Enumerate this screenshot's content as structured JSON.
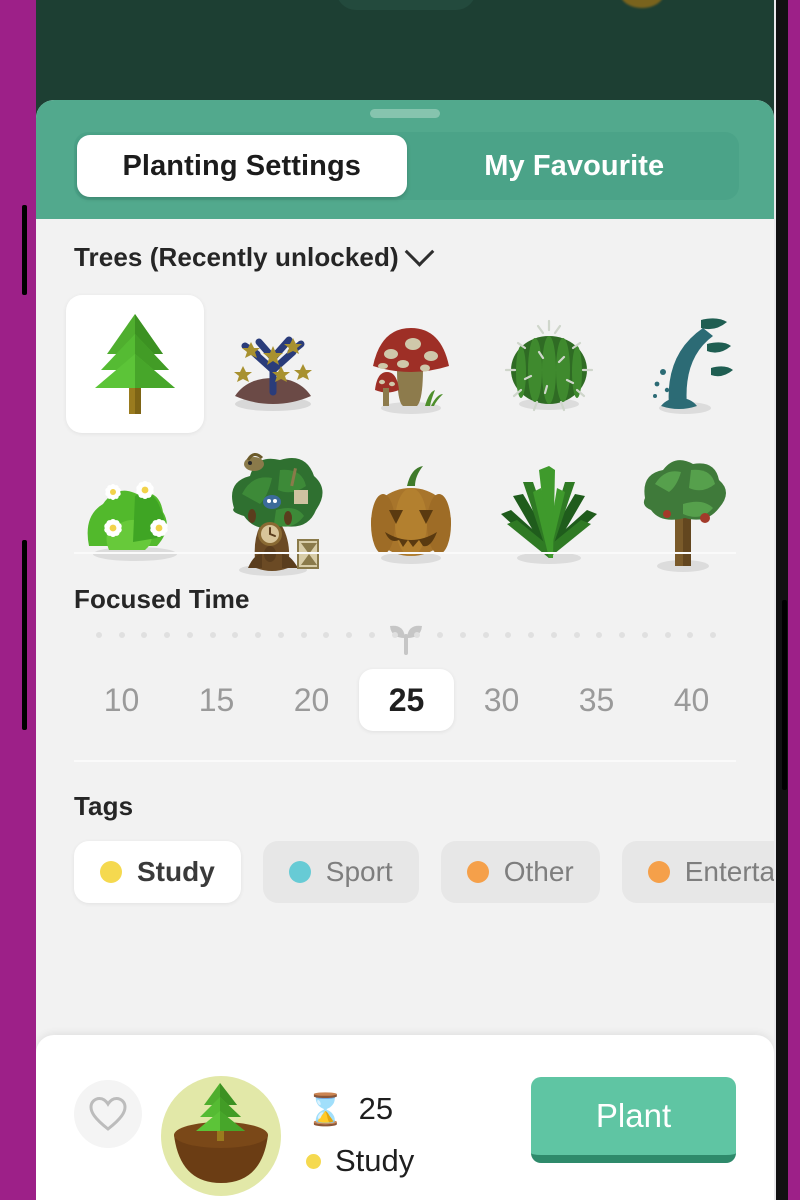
{
  "tabs": {
    "items": [
      {
        "label": "Planting Settings",
        "active": true
      },
      {
        "label": "My Favourite",
        "active": false
      }
    ]
  },
  "trees": {
    "section_label": "Trees (Recently unlocked)",
    "expand_icon": "chevron-down-icon",
    "rows": [
      [
        {
          "name": "pine-tree",
          "selected": true
        },
        {
          "name": "blue-star-bush",
          "selected": false
        },
        {
          "name": "red-mushroom",
          "selected": false
        },
        {
          "name": "round-cactus",
          "selected": false
        },
        {
          "name": "teal-fountain-plant",
          "selected": false
        }
      ],
      [
        {
          "name": "flower-bush",
          "selected": false
        },
        {
          "name": "clock-treehouse",
          "selected": false
        },
        {
          "name": "jack-o-lantern",
          "selected": false
        },
        {
          "name": "agave-plant",
          "selected": false
        },
        {
          "name": "broadleaf-tree",
          "selected": false
        }
      ]
    ]
  },
  "focused_time": {
    "section_label": "Focused Time",
    "marker_icon": "sprout-icon",
    "tick_count": 28,
    "options": [
      "10",
      "15",
      "20",
      "25",
      "30",
      "35",
      "40"
    ],
    "selected": "25"
  },
  "tags": {
    "section_label": "Tags",
    "items": [
      {
        "label": "Study",
        "color": "#f5d94f",
        "selected": true
      },
      {
        "label": "Sport",
        "color": "#67cbd5",
        "selected": false
      },
      {
        "label": "Other",
        "color": "#f5a04a",
        "selected": false
      },
      {
        "label": "Entertai",
        "color": "#f5a04a",
        "selected": false
      }
    ]
  },
  "bottom_bar": {
    "favourite_icon": "heart-icon",
    "avatar_icon": "planted-tree-avatar",
    "duration_icon": "hourglass-icon",
    "duration": "25",
    "tag_label": "Study",
    "tag_color": "#f5d94f",
    "plant_button": "Plant"
  },
  "theme": {
    "accent_green": "#52a98d",
    "backdrop_green": "#1d3f33",
    "sheet_bg": "#f2f2f2",
    "plant_button": "#5fc5a3",
    "plant_button_shadow": "#2e8a6b",
    "frame_purple": "#9d2088"
  }
}
